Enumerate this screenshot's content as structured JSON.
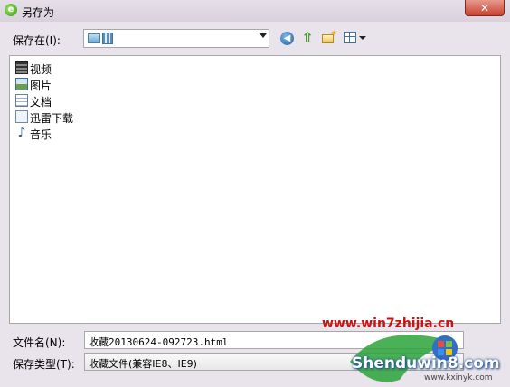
{
  "window": {
    "title": "另存为",
    "close_label": "✕"
  },
  "toolbar": {
    "save_in_label": "保存在(I):",
    "location_value": "",
    "back_icon": "back-arrow-icon",
    "up_icon": "up-folder-icon",
    "new_folder_icon": "new-folder-icon",
    "views_icon": "view-menu-icon"
  },
  "file_list": {
    "items": [
      {
        "label": "视频",
        "icon": "video-library-icon"
      },
      {
        "label": "图片",
        "icon": "pictures-library-icon"
      },
      {
        "label": "文档",
        "icon": "documents-library-icon"
      },
      {
        "label": "迅雷下载",
        "icon": "download-folder-icon"
      },
      {
        "label": "音乐",
        "icon": "music-library-icon"
      }
    ]
  },
  "bottom": {
    "filename_label": "文件名(N):",
    "filename_value": "收藏20130624-092723.html",
    "filetype_label": "保存类型(T):",
    "filetype_value": "收藏文件(兼容IE8、IE9)"
  },
  "watermark": {
    "site": "www.win7zhijia.cn",
    "domain": "Shenduwin8.com",
    "sub": "www.kxinyk.com"
  },
  "colors": {
    "titlebar": "#e6dfe8",
    "close_button": "#c8422f",
    "watermark_red": "#cc1111"
  }
}
